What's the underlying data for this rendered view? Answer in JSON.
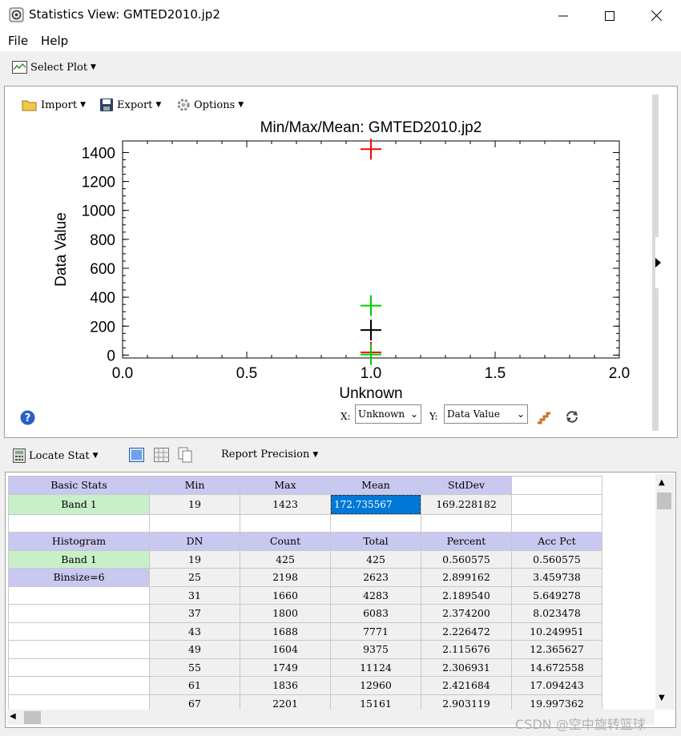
{
  "window": {
    "title": "Statistics View: GMTED2010.jp2",
    "minimize_icon": "minimize-icon",
    "maximize_icon": "maximize-icon",
    "close_icon": "close-icon"
  },
  "menu": [
    "File",
    "Help"
  ],
  "toolbar": {
    "select_plot_label": "Select Plot"
  },
  "plot_toolbar": {
    "import_label": "Import",
    "export_label": "Export",
    "options_label": "Options"
  },
  "chart_data": {
    "type": "scatter",
    "title": "Min/Max/Mean: GMTED2010.jp2",
    "xlabel": "Unknown",
    "ylabel": "Data Value",
    "xlim": [
      0.0,
      2.0
    ],
    "ylim": [
      -20,
      1480
    ],
    "xticks": [
      "0.0",
      "0.5",
      "1.0",
      "1.5",
      "2.0"
    ],
    "yticks": [
      0,
      200,
      400,
      600,
      800,
      1000,
      1200,
      1400
    ],
    "points": [
      {
        "x": 1.0,
        "y": 1423,
        "color": "#ff0000"
      },
      {
        "x": 1.0,
        "y": 342,
        "color": "#00cc00"
      },
      {
        "x": 1.0,
        "y": 173,
        "color": "#000000"
      },
      {
        "x": 1.0,
        "y": 19,
        "color": "#ff0000"
      },
      {
        "x": 1.0,
        "y": 4,
        "color": "#00cc00"
      }
    ]
  },
  "axis_selectors": {
    "x_label": "X:",
    "x_value": "Unknown",
    "y_label": "Y:",
    "y_value": "Data Value"
  },
  "bottom_toolbar": {
    "locate_stat_label": "Locate Stat",
    "report_precision_label": "Report Precision"
  },
  "basic_stats": {
    "header": [
      "Basic Stats",
      "Min",
      "Max",
      "Mean",
      "StdDev"
    ],
    "row": [
      "Band 1",
      "19",
      "1423",
      "172.735567",
      "169.228182"
    ]
  },
  "histogram": {
    "header": [
      "Histogram",
      "DN",
      "Count",
      "Total",
      "Percent",
      "Acc Pct"
    ],
    "labels": [
      "Band 1",
      "Binsize=6"
    ],
    "rows": [
      [
        "19",
        "425",
        "425",
        "0.560575",
        "0.560575"
      ],
      [
        "25",
        "2198",
        "2623",
        "2.899162",
        "3.459738"
      ],
      [
        "31",
        "1660",
        "4283",
        "2.189540",
        "5.649278"
      ],
      [
        "37",
        "1800",
        "6083",
        "2.374200",
        "8.023478"
      ],
      [
        "43",
        "1688",
        "7771",
        "2.226472",
        "10.249951"
      ],
      [
        "49",
        "1604",
        "9375",
        "2.115676",
        "12.365627"
      ],
      [
        "55",
        "1749",
        "11124",
        "2.306931",
        "14.672558"
      ],
      [
        "61",
        "1836",
        "12960",
        "2.421684",
        "17.094243"
      ],
      [
        "67",
        "2201",
        "15161",
        "2.903119",
        "19.997362"
      ]
    ]
  },
  "watermark": "CSDN @空中旋转篮球",
  "colors": {
    "header": "#c8c8f0",
    "band": "#c8f0c8",
    "selected": "#0078d7"
  }
}
